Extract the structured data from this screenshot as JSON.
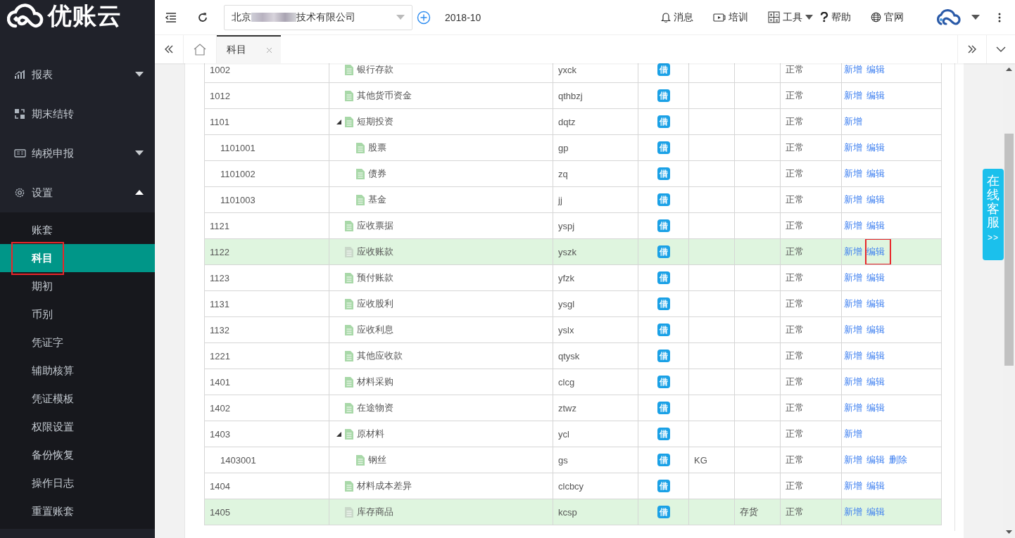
{
  "logo": {
    "text": "优账云"
  },
  "sidebar": {
    "items": [
      {
        "label": "报表",
        "expanded": false
      },
      {
        "label": "期末结转"
      },
      {
        "label": "纳税申报",
        "expanded": false
      },
      {
        "label": "设置",
        "expanded": true,
        "children": [
          {
            "label": "账套",
            "selected": false,
            "outlined": false
          },
          {
            "label": "科目",
            "selected": true,
            "outlined": true
          },
          {
            "label": "期初",
            "selected": false,
            "outlined": false
          },
          {
            "label": "币别",
            "selected": false,
            "outlined": false
          },
          {
            "label": "凭证字",
            "selected": false,
            "outlined": false
          },
          {
            "label": "辅助核算",
            "selected": false,
            "outlined": false
          },
          {
            "label": "凭证模板",
            "selected": false,
            "outlined": false
          },
          {
            "label": "权限设置",
            "selected": false,
            "outlined": false
          },
          {
            "label": "备份恢复",
            "selected": false,
            "outlined": false
          },
          {
            "label": "操作日志",
            "selected": false,
            "outlined": false
          },
          {
            "label": "重置账套",
            "selected": false,
            "outlined": false
          }
        ]
      }
    ]
  },
  "toolbar": {
    "company": {
      "name_start": "北京",
      "name_end": "技术有限公司"
    },
    "period": "2018-10",
    "links": [
      {
        "label": "消息",
        "dropdown": false
      },
      {
        "label": "培训",
        "dropdown": false
      },
      {
        "label": "工具",
        "dropdown": true
      },
      {
        "label": "帮助",
        "dropdown": false
      },
      {
        "label": "官网",
        "dropdown": false
      }
    ]
  },
  "tabs": [
    {
      "label": "科目",
      "selected": true,
      "closable": true
    }
  ],
  "table": {
    "rows": [
      {
        "code": "1002",
        "name": "银行存款",
        "pinyin": "yxck",
        "direction": "借",
        "color": "#1ba1e6",
        "status": "正常",
        "actions": [
          {
            "label": "新增",
            "outlined": false
          },
          {
            "label": "编辑",
            "outlined": false
          }
        ],
        "selected": false
      },
      {
        "code": "1012",
        "name": "其他货币资金",
        "pinyin": "qthbzj",
        "direction": "借",
        "color": "#1ba1e6",
        "status": "正常",
        "actions": [
          {
            "label": "新增",
            "outlined": false
          },
          {
            "label": "编辑",
            "outlined": false
          }
        ],
        "selected": false
      },
      {
        "code": "1101",
        "name": "短期投资",
        "pinyin": "dqtz",
        "direction": "借",
        "color": "#1ba1e6",
        "status": "正常",
        "actions": [
          {
            "label": "新增",
            "outlined": false
          }
        ],
        "selected": false,
        "expanded": true,
        "children": [
          {
            "code": "1101001",
            "name": "股票",
            "pinyin": "gp",
            "direction": "借",
            "color": "#1ba1e6",
            "status": "正常",
            "actions": [
              {
                "label": "新增",
                "outlined": false
              },
              {
                "label": "编辑",
                "outlined": false
              }
            ],
            "selected": false
          },
          {
            "code": "1101002",
            "name": "债券",
            "pinyin": "zq",
            "direction": "借",
            "color": "#1ba1e6",
            "status": "正常",
            "actions": [
              {
                "label": "新增",
                "outlined": false
              },
              {
                "label": "编辑",
                "outlined": false
              }
            ],
            "selected": false
          },
          {
            "code": "1101003",
            "name": "基金",
            "pinyin": "jj",
            "direction": "借",
            "color": "#1ba1e6",
            "status": "正常",
            "actions": [
              {
                "label": "新增",
                "outlined": false
              },
              {
                "label": "编辑",
                "outlined": false
              }
            ],
            "selected": false
          }
        ]
      },
      {
        "code": "1121",
        "name": "应收票据",
        "pinyin": "yspj",
        "direction": "借",
        "color": "#1ba1e6",
        "status": "正常",
        "actions": [
          {
            "label": "新增",
            "outlined": false
          },
          {
            "label": "编辑",
            "outlined": false
          }
        ],
        "selected": false
      },
      {
        "code": "1122",
        "name": "应收账款",
        "pinyin": "yszk",
        "direction": "借",
        "color": "#1ba1e6",
        "status": "正常",
        "actions": [
          {
            "label": "新增",
            "outlined": false
          },
          {
            "label": "编辑",
            "outlined": true
          }
        ],
        "selected": true
      },
      {
        "code": "1123",
        "name": "预付账款",
        "pinyin": "yfzk",
        "direction": "借",
        "color": "#1ba1e6",
        "status": "正常",
        "actions": [
          {
            "label": "新增",
            "outlined": false
          },
          {
            "label": "编辑",
            "outlined": false
          }
        ],
        "selected": false
      },
      {
        "code": "1131",
        "name": "应收股利",
        "pinyin": "ysgl",
        "direction": "借",
        "color": "#1ba1e6",
        "status": "正常",
        "actions": [
          {
            "label": "新增",
            "outlined": false
          },
          {
            "label": "编辑",
            "outlined": false
          }
        ],
        "selected": false
      },
      {
        "code": "1132",
        "name": "应收利息",
        "pinyin": "yslx",
        "direction": "借",
        "color": "#1ba1e6",
        "status": "正常",
        "actions": [
          {
            "label": "新增",
            "outlined": false
          },
          {
            "label": "编辑",
            "outlined": false
          }
        ],
        "selected": false
      },
      {
        "code": "1221",
        "name": "其他应收款",
        "pinyin": "qtysk",
        "direction": "借",
        "color": "#1ba1e6",
        "status": "正常",
        "actions": [
          {
            "label": "新增",
            "outlined": false
          },
          {
            "label": "编辑",
            "outlined": false
          }
        ],
        "selected": false
      },
      {
        "code": "1401",
        "name": "材料采购",
        "pinyin": "clcg",
        "direction": "借",
        "color": "#1ba1e6",
        "status": "正常",
        "actions": [
          {
            "label": "新增",
            "outlined": false
          },
          {
            "label": "编辑",
            "outlined": false
          }
        ],
        "selected": false
      },
      {
        "code": "1402",
        "name": "在途物资",
        "pinyin": "ztwz",
        "direction": "借",
        "color": "#1ba1e6",
        "status": "正常",
        "actions": [
          {
            "label": "新增",
            "outlined": false
          },
          {
            "label": "编辑",
            "outlined": false
          }
        ],
        "selected": false
      },
      {
        "code": "1403",
        "name": "原材料",
        "pinyin": "ycl",
        "direction": "借",
        "color": "#1ba1e6",
        "status": "正常",
        "actions": [
          {
            "label": "新增",
            "outlined": false
          }
        ],
        "selected": false,
        "expanded": true,
        "children": [
          {
            "code": "1403001",
            "name": "钢丝",
            "pinyin": "gs",
            "direction": "借",
            "color": "#1ba1e6",
            "unit": "KG",
            "status": "正常",
            "actions": [
              {
                "label": "新增",
                "outlined": false
              },
              {
                "label": "编辑",
                "outlined": false
              },
              {
                "label": "删除",
                "outlined": false
              }
            ],
            "selected": false
          }
        ]
      },
      {
        "code": "1404",
        "name": "材料成本差异",
        "pinyin": "clcbcy",
        "direction": "借",
        "color": "#1ba1e6",
        "status": "正常",
        "actions": [
          {
            "label": "新增",
            "outlined": false
          },
          {
            "label": "编辑",
            "outlined": false
          }
        ],
        "selected": false
      },
      {
        "code": "1405",
        "name": "库存商品",
        "pinyin": "kcsp",
        "direction": "借",
        "color": "#1ba1e6",
        "category": "存货",
        "status": "正常",
        "actions": [
          {
            "label": "新增",
            "outlined": false
          },
          {
            "label": "编辑",
            "outlined": false
          }
        ],
        "selected": true
      }
    ]
  },
  "service": {
    "label": "在线客服",
    "arrow": ">>"
  }
}
